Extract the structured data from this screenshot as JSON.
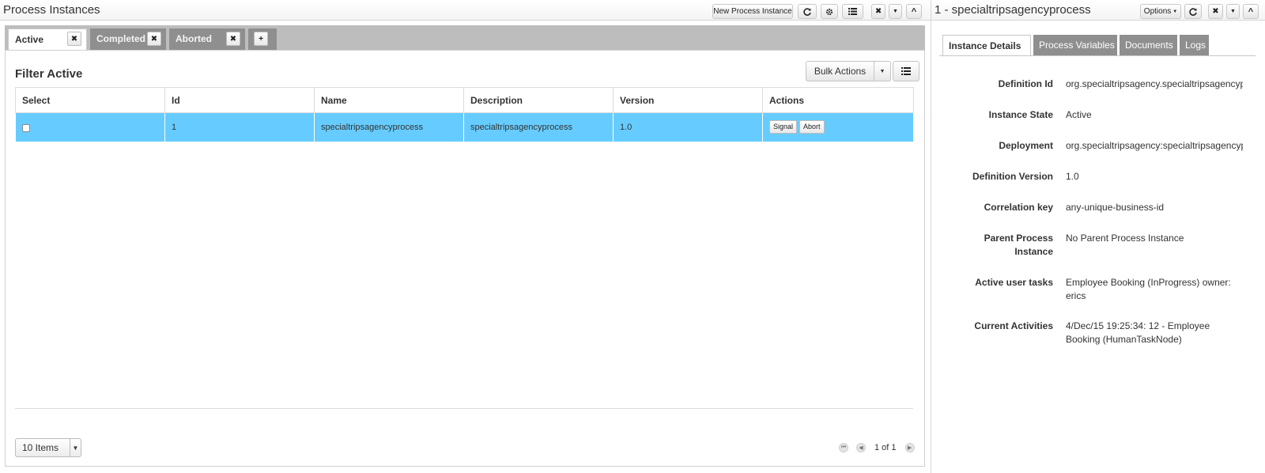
{
  "left_panel": {
    "title": "Process Instances",
    "toolbar": {
      "new_instance_label": "New Process Instance"
    },
    "tabs": [
      {
        "label": "Active"
      },
      {
        "label": "Completed"
      },
      {
        "label": "Aborted"
      },
      {
        "label": "+"
      }
    ],
    "filter_title": "Filter Active",
    "bulk_actions_label": "Bulk Actions",
    "grid": {
      "columns": [
        "Select",
        "Id",
        "Name",
        "Description",
        "Version",
        "Actions"
      ],
      "rows": [
        {
          "id": "1",
          "name": "specialtripsagencyprocess",
          "description": "specialtripsagencyprocess",
          "version": "1.0",
          "signal_label": "Signal",
          "abort_label": "Abort"
        }
      ]
    },
    "page_size": "10 Items",
    "pager_text": "1 of 1"
  },
  "right_panel": {
    "title": "1 - specialtripsagencyprocess",
    "options_label": "Options",
    "tabs": [
      {
        "label": "Instance Details"
      },
      {
        "label": "Process Variables"
      },
      {
        "label": "Documents"
      },
      {
        "label": "Logs"
      }
    ],
    "details": [
      {
        "label": "Definition Id",
        "value": "org.specialtripsagency.specialtripsagencypr"
      },
      {
        "label": "Instance State",
        "value": "Active"
      },
      {
        "label": "Deployment",
        "value": "org.specialtripsagency:specialtripsagencypr"
      },
      {
        "label": "Definition Version",
        "value": "1.0"
      },
      {
        "label": "Correlation key",
        "value": "any-unique-business-id"
      },
      {
        "label": "Parent Process Instance",
        "value": "No Parent Process Instance"
      },
      {
        "label": "Active user tasks",
        "value": "Employee Booking (InProgress) owner: erics"
      },
      {
        "label": "Current Activities",
        "value": "4/Dec/15 19:25:34: 12 - Employee Booking (HumanTaskNode)"
      }
    ]
  },
  "colors": {
    "selected_row": "#66ccff",
    "inactive_tab": "#8f8f8f",
    "tabstrip": "#bdbdbd"
  }
}
